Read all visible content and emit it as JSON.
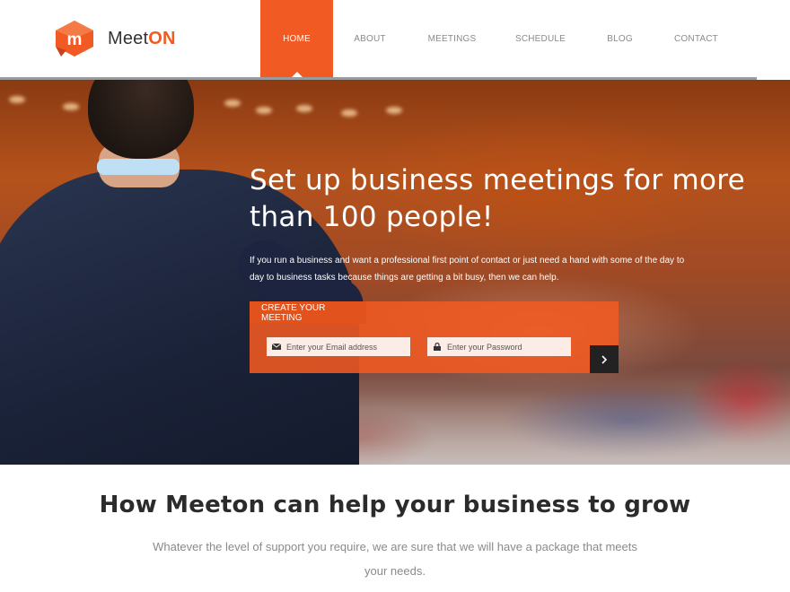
{
  "brand": {
    "name_part1": "Meet",
    "name_part2": "ON",
    "logo_letter": "m",
    "accent_color": "#f15a22"
  },
  "nav": {
    "items": [
      {
        "label": "HOME",
        "active": true
      },
      {
        "label": "ABOUT",
        "active": false
      },
      {
        "label": "MEETINGS",
        "active": false
      },
      {
        "label": "SCHEDULE",
        "active": false
      },
      {
        "label": "BLOG",
        "active": false
      },
      {
        "label": "CONTACT",
        "active": false
      }
    ]
  },
  "hero": {
    "title": "Set up business meetings for more than 100 people!",
    "subtitle": "If you run a business and want a professional first point of contact or just need a hand with some of the day to day to business tasks because things are getting a bit busy, then we can help.",
    "form": {
      "tab_label": "CREATE YOUR MEETING",
      "email_placeholder": "Enter your Email address",
      "password_placeholder": "Enter your Password",
      "email_icon": "envelope-icon",
      "password_icon": "lock-icon",
      "submit_icon": "chevron-right-icon"
    }
  },
  "section": {
    "title": "How Meeton can help your business to grow",
    "text": "Whatever the level of support you require, we are sure that we will have a package that meets your needs."
  }
}
